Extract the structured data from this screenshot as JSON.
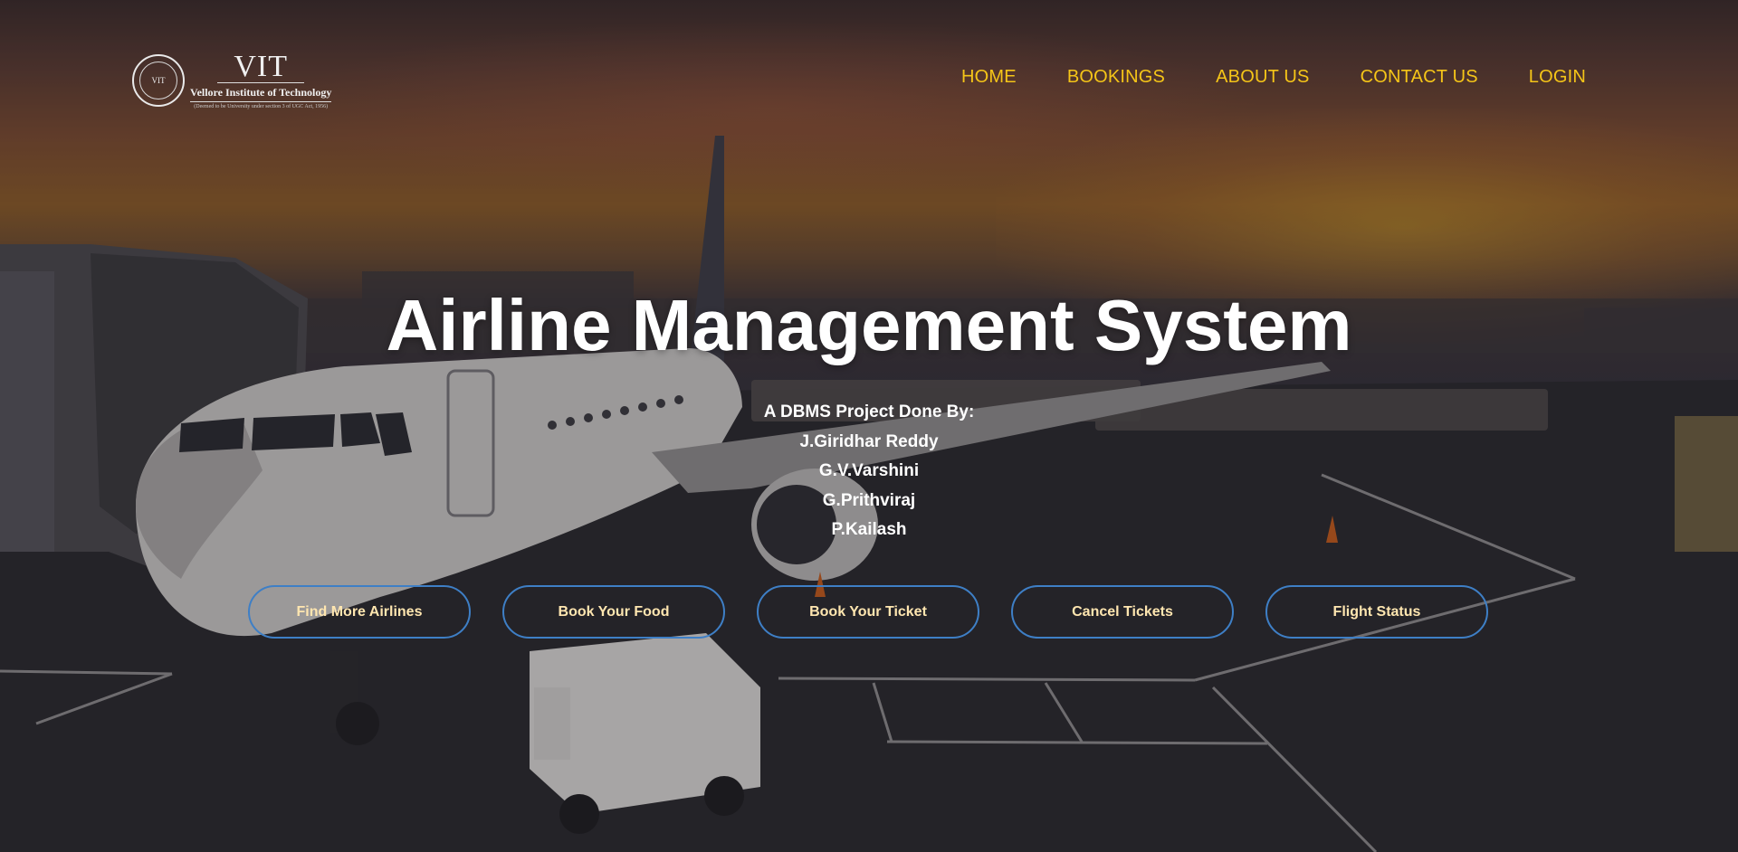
{
  "logo": {
    "seal_text": "VIT",
    "name": "VIT",
    "full_name": "Vellore Institute of Technology",
    "subtitle": "(Deemed to be University under section 3 of UGC Act, 1956)"
  },
  "nav": {
    "items": [
      {
        "label": "HOME"
      },
      {
        "label": "BOOKINGS"
      },
      {
        "label": "ABOUT US"
      },
      {
        "label": "CONTACT US"
      },
      {
        "label": "LOGIN"
      }
    ]
  },
  "hero": {
    "title": "Airline Management System",
    "credits_heading": "A DBMS Project Done By:",
    "members": [
      "J.Giridhar Reddy",
      "G.V.Varshini",
      "G.Prithviraj",
      "P.Kailash"
    ]
  },
  "actions": [
    {
      "label": "Find More Airlines"
    },
    {
      "label": "Book Your Food"
    },
    {
      "label": "Book Your Ticket"
    },
    {
      "label": "Cancel Tickets"
    },
    {
      "label": "Flight Status"
    }
  ],
  "colors": {
    "nav_text": "#f5c518",
    "button_border": "#3e7fc6",
    "button_text": "#ffe6b0",
    "title_text": "#ffffff"
  }
}
